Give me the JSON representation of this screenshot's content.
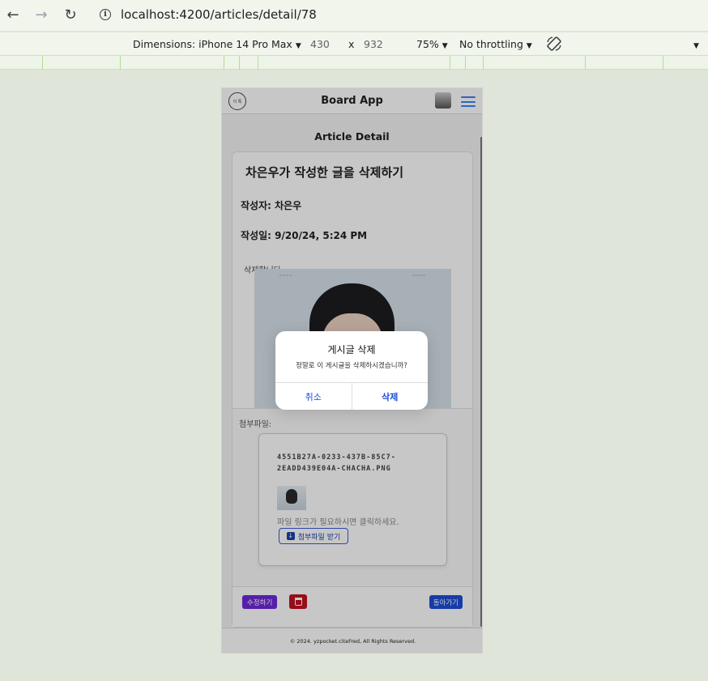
{
  "browser": {
    "url": "localhost:4200/articles/detail/78"
  },
  "devtools": {
    "dimensions_label": "Dimensions: iPhone 14 Pro Max",
    "width": "430",
    "times": "x",
    "height": "932",
    "zoom": "75%",
    "throttling": "No throttling"
  },
  "app": {
    "title": "Board App",
    "logo_text": "이 톡",
    "page_heading": "Article Detail",
    "article": {
      "title": "차은우가 작성한 글을 삭제하기",
      "author_line": "작성자: 차은우",
      "date_line": "작성일: 9/20/24, 5:24 PM",
      "body": "삭제합니다."
    },
    "attachments": {
      "label": "첨부파일:",
      "file_name": "4551B27A-0233-437B-85C7-2EADD439E04A-CHACHA.PNG",
      "hint": "파일 링크가 필요하시면 클릭하세요.",
      "download_label": "첨부파일 받기"
    },
    "actions": {
      "edit_label": "수정하기",
      "back_label": "돌아가기"
    },
    "footer": "© 2024. yzpocket.citeFred, All Rights Reserved."
  },
  "dialog": {
    "title": "게시글 삭제",
    "message": "정말로 이 게시글을 삭제하시겠습니까?",
    "cancel_label": "취소",
    "confirm_label": "삭제"
  },
  "colors": {
    "edit_button": "#6d28d9",
    "delete_button": "#c1121f",
    "back_button": "#1d4ed8",
    "dialog_accent": "#1d4ed8"
  }
}
